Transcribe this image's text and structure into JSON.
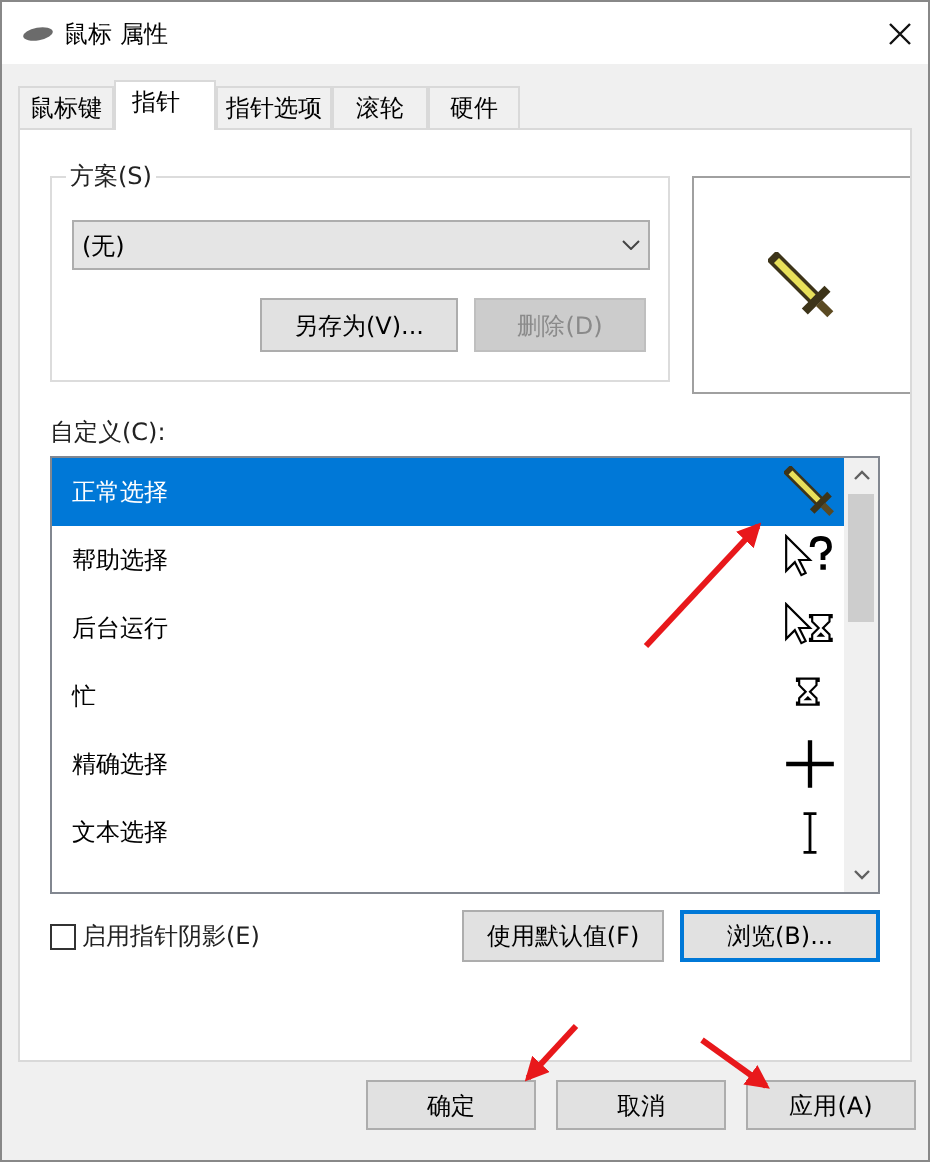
{
  "window": {
    "title": "鼠标 属性"
  },
  "tabs": [
    {
      "label": "鼠标键",
      "selected": false
    },
    {
      "label": "指针",
      "selected": true
    },
    {
      "label": "指针选项",
      "selected": false
    },
    {
      "label": "滚轮",
      "selected": false
    },
    {
      "label": "硬件",
      "selected": false
    }
  ],
  "scheme": {
    "legend": "方案(S)",
    "value": "(无)",
    "buttons": [
      {
        "label": "另存为(V)...",
        "disabled": false
      },
      {
        "label": "删除(D)",
        "disabled": true
      }
    ]
  },
  "customize_label": "自定义(C):",
  "cursors": [
    {
      "name": "正常选择",
      "selected": true,
      "kind": "sword"
    },
    {
      "name": "帮助选择",
      "selected": false,
      "kind": "help"
    },
    {
      "name": "后台运行",
      "selected": false,
      "kind": "working"
    },
    {
      "name": "忙",
      "selected": false,
      "kind": "busy"
    },
    {
      "name": "精确选择",
      "selected": false,
      "kind": "cross"
    },
    {
      "name": "文本选择",
      "selected": false,
      "kind": "text"
    }
  ],
  "shadow_checkbox": {
    "label": "启用指针阴影(E)",
    "checked": false
  },
  "list_buttons": [
    {
      "label": "使用默认值(F)",
      "focused": false
    },
    {
      "label": "浏览(B)...",
      "focused": true
    }
  ],
  "dialog_buttons": [
    {
      "label": "确定"
    },
    {
      "label": "取消"
    },
    {
      "label": "应用(A)"
    }
  ]
}
